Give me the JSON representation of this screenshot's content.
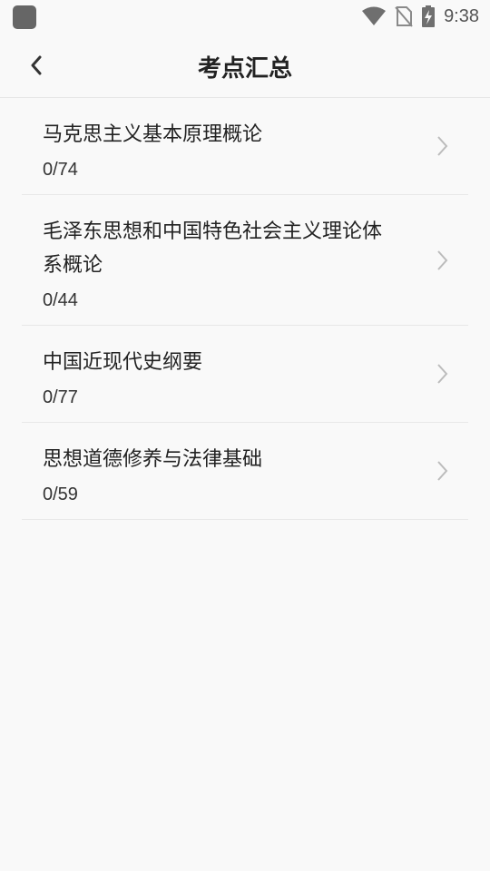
{
  "status_bar": {
    "time": "9:38",
    "icons": [
      "app-icon",
      "wifi-icon",
      "no-sim-icon",
      "battery-charging-icon"
    ]
  },
  "header": {
    "back_icon": "chevron-left-icon",
    "title": "考点汇总"
  },
  "list": {
    "items": [
      {
        "title": "马克思主义基本原理概论",
        "progress": "0/74"
      },
      {
        "title": "毛泽东思想和中国特色社会主义理论体系概论",
        "progress": "0/44"
      },
      {
        "title": "中国近现代史纲要",
        "progress": "0/77"
      },
      {
        "title": "思想道德修养与法律基础",
        "progress": "0/59"
      }
    ],
    "row_icon": "chevron-right-icon"
  }
}
